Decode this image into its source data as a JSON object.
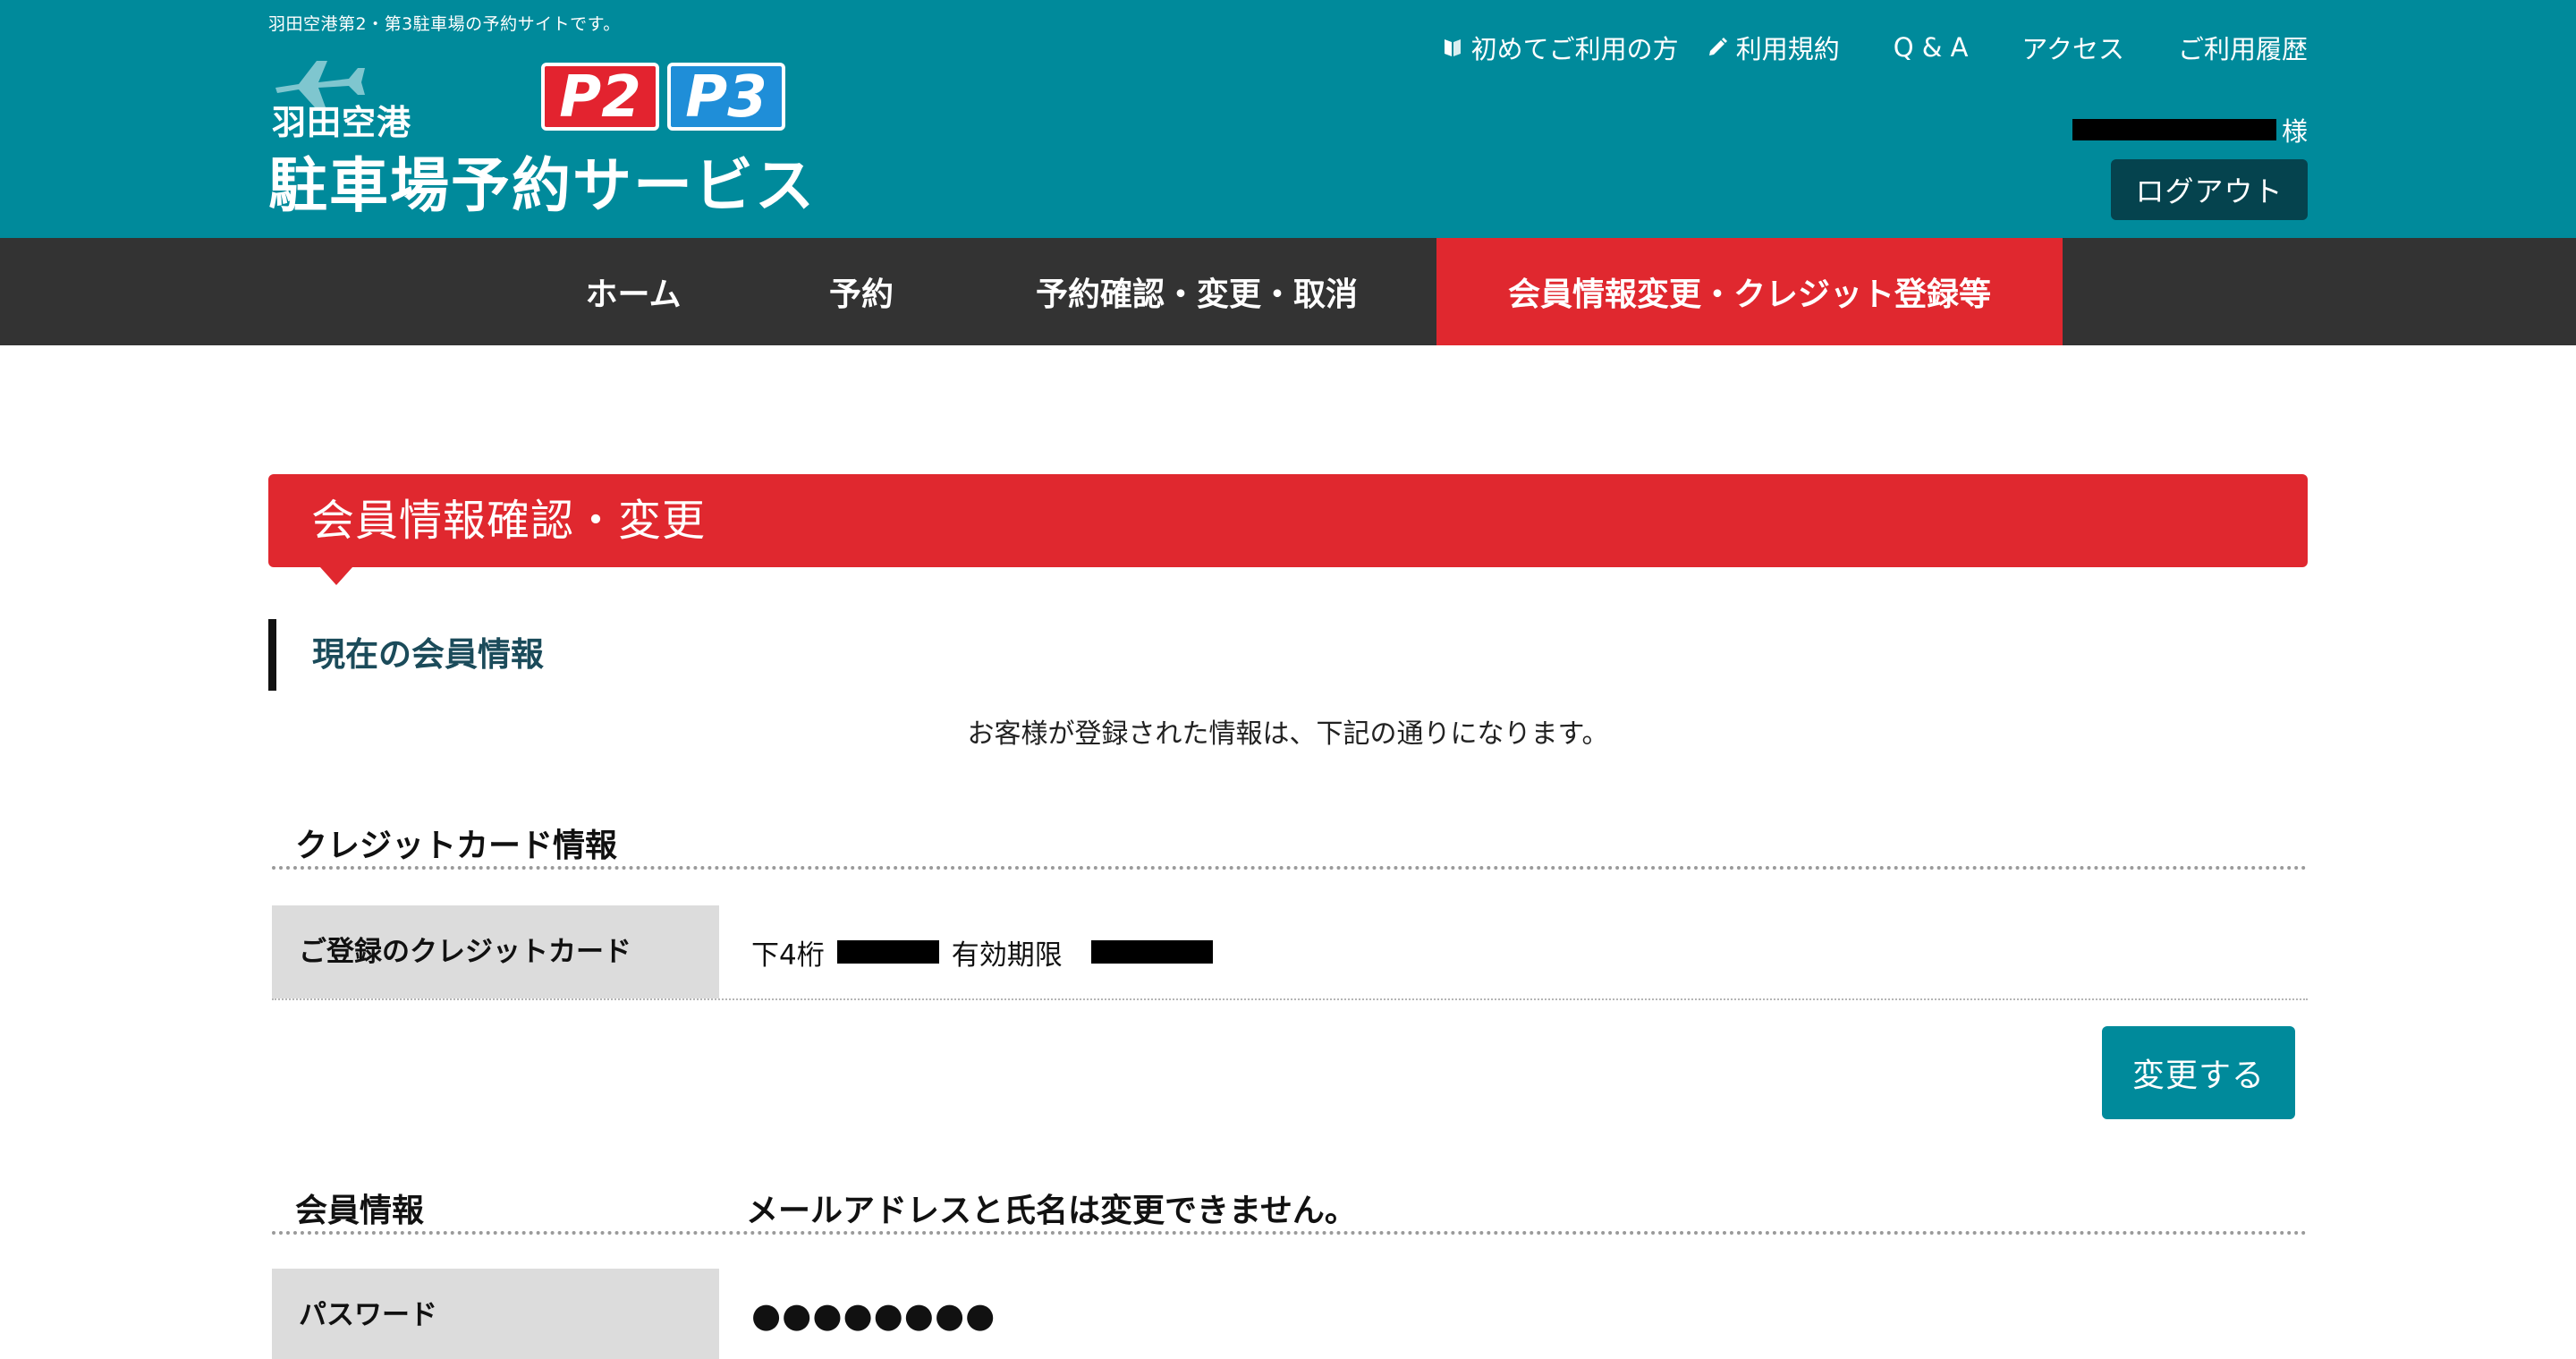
{
  "header": {
    "tagline": "羽田空港第2・第3駐車場の予約サイトです。",
    "logo_sub": "羽田空港",
    "logo_main": "駐車場予約サービス",
    "badge_p2": "P2",
    "badge_p3": "P3",
    "links": [
      {
        "label": "初めてご利用の方",
        "icon": "book-icon"
      },
      {
        "label": "利用規約",
        "icon": "pencil-icon"
      },
      {
        "label": "Q & A"
      },
      {
        "label": "アクセス"
      },
      {
        "label": "ご利用履歴"
      }
    ],
    "user_suffix": "様",
    "logout_label": "ログアウト"
  },
  "nav": {
    "items": [
      {
        "label": "ホーム"
      },
      {
        "label": "予約"
      },
      {
        "label": "予約確認・変更・取消"
      },
      {
        "label": "会員情報変更・クレジット登録等",
        "active": true
      }
    ]
  },
  "main": {
    "section_title": "会員情報確認・変更",
    "sub_title": "現在の会員情報",
    "intro": "お客様が登録された情報は、下記の通りになります。",
    "credit": {
      "heading": "クレジットカード情報",
      "row_label": "ご登録のクレジットカード",
      "last4_label": "下4桁",
      "expiry_label": "有効期限"
    },
    "change_button": "変更する",
    "member": {
      "heading": "会員情報",
      "note": "メールアドレスと氏名は変更できません。",
      "password_label": "パスワード",
      "password_mask": "●●●●●●●●"
    }
  },
  "colors": {
    "header_bg": "#008a9b",
    "nav_bg": "#333333",
    "accent_red": "#e0282f",
    "logout_bg": "#05434e"
  }
}
